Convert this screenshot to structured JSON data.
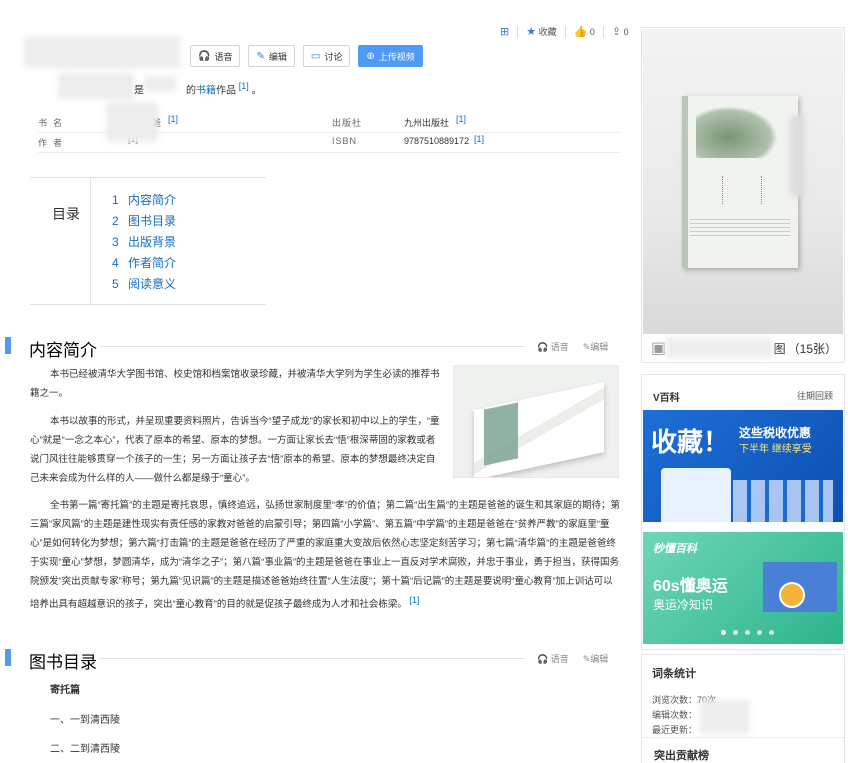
{
  "actions": {
    "collect_label": "收藏",
    "like_count": "0",
    "share_count": "0"
  },
  "toolbar": {
    "voice_label": "语音",
    "edit_label": "编辑",
    "discuss_label": "讨论",
    "upload_video_label": "上传视频"
  },
  "intro": {
    "text_a": "是",
    "text_b": "的",
    "link": "书籍",
    "text_c": "作品",
    "ref": "[1]",
    "end": "。"
  },
  "infobox": {
    "rows": [
      {
        "k1": "书名",
        "v1": "爸",
        "r1": "[1]",
        "k2": "出版社",
        "v2": "九州出版社",
        "r2": "[1]"
      },
      {
        "k1": "作者",
        "v1": "",
        "r1": "[1]",
        "k2": "ISBN",
        "v2": "9787510889172",
        "r2": "[1]"
      }
    ]
  },
  "toc": {
    "title": "目录",
    "items": [
      {
        "num": "1",
        "label": "内容简介"
      },
      {
        "num": "2",
        "label": "图书目录"
      },
      {
        "num": "3",
        "label": "出版背景"
      },
      {
        "num": "4",
        "label": "作者简介"
      },
      {
        "num": "5",
        "label": "阅读意义"
      }
    ]
  },
  "section1": {
    "title": "内容简介",
    "voice": "语音",
    "edit": "编辑",
    "p1": "本书已经被清华大学图书馆、校史馆和档案馆收录珍藏，并被清华大学列为学生必读的推荐书籍之一。",
    "p2": "本书以故事的形式，并呈现重要资料照片，告诉当今“望子成龙”的家长和初中以上的学生，“童心”就是“一念之本心”，代表了原本的希望、原本的梦想。一方面让家长去“悟”根深蒂固的家教或者说门风往往能够贯穿一个孩子的一生；另一方面让孩子去“悟”原本的希望、原本的梦想最终决定自己未来会成为什么样的人——做什么都是缘于“童心”。",
    "p3": "全书第一篇“寄托篇”的主题是寄托哀思，慎终追远，弘扬世家制度里“孝”的价值；第二篇“出生篇”的主题是爸爸的诞生和其家庭的期待；第三篇“家风篇”的主题是建性现实有责任感的家教对爸爸的启蒙引导；第四篇“小学篇”、第五篇“中学篇”的主题是爸爸在“贫养严教”的家庭里“童心”是如何转化为梦想；第六篇“打击篇”的主题是爸爸在经历了严重的家庭重大变故后依然心志坚定刻苦学习；第七篇“清华篇”的主题是爸爸终于实现“童心”梦想，梦圆清华，成为“清华之子”；第八篇“事业篇”的主题是爸爸在事业上一直反对学术腐败，并忠于事业，勇于担当，获得国务院颁发“突出贡献专家”称号；第九篇“见识篇”的主题是描述爸爸始终往置“人生法度”；第十篇“后记篇”的主题是要说明“童心教育”加上训诂可以培养出具有超越意识的孩子，突出“童心教育”的目的就是促孩子最终成为人才和社会栋梁。",
    "p3_ref": "[1]"
  },
  "section2": {
    "title": "图书目录",
    "voice": "语音",
    "edit": "编辑",
    "sub": "寄托篇",
    "items": [
      "一、一到清西陵",
      "二、二到清西陵"
    ]
  },
  "cover": {
    "album_suffix": "图",
    "count": "（15张）"
  },
  "vbaike": {
    "title": "V百科",
    "past": "往期回顾",
    "banner1_big": "收藏！",
    "banner1_line1": "这些税收优惠",
    "banner1_line2": "下半年 继续享受",
    "banner2_brand": "秒懂百科",
    "banner2_big": "60s懂奥运",
    "banner2_sub": "奥运冷知识"
  },
  "stats": {
    "title": "词条统计",
    "views_label": "浏览次数：",
    "views": "70次",
    "edits_label": "编辑次数：",
    "updated_label": "最近更新：",
    "contrib_title": "突出贡献榜"
  },
  "colors": {
    "accent": "#4f9cee",
    "link": "#136ec2",
    "primary_button": "#4d9bf5"
  }
}
